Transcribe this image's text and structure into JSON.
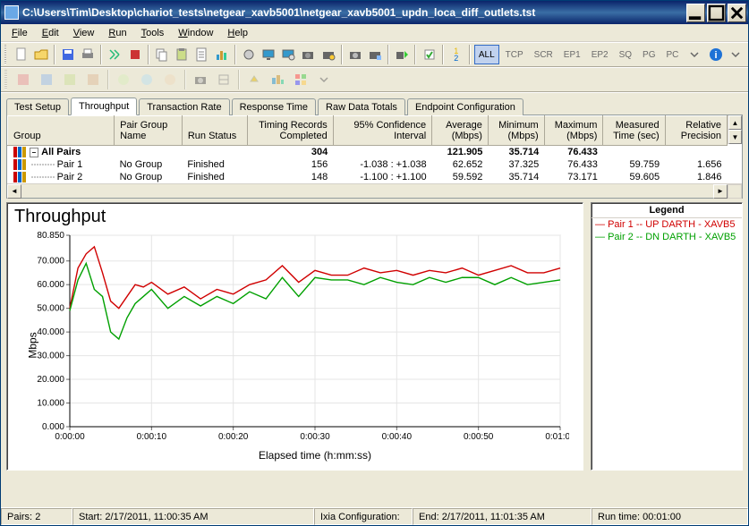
{
  "window": {
    "title": "C:\\Users\\Tim\\Desktop\\chariot_tests\\netgear_xavb5001\\netgear_xavb5001_updn_loca_diff_outlets.tst"
  },
  "menu": {
    "file": "File",
    "edit": "Edit",
    "view": "View",
    "run": "Run",
    "tools": "Tools",
    "window": "Window",
    "help": "Help"
  },
  "filter_buttons": {
    "all": "ALL",
    "tcp": "TCP",
    "scr": "SCR",
    "ep1": "EP1",
    "ep2": "EP2",
    "sq": "SQ",
    "pg": "PG",
    "pc": "PC",
    "halves": "1\n2"
  },
  "tabs": {
    "test_setup": "Test Setup",
    "throughput": "Throughput",
    "transaction_rate": "Transaction Rate",
    "response_time": "Response Time",
    "raw_data_totals": "Raw Data Totals",
    "endpoint_config": "Endpoint Configuration"
  },
  "columns": {
    "group": "Group",
    "pair_group_name": "Pair Group Name",
    "run_status": "Run Status",
    "timing_records": "Timing Records Completed",
    "confidence": "95% Confidence Interval",
    "average": "Average (Mbps)",
    "minimum": "Minimum (Mbps)",
    "maximum": "Maximum (Mbps)",
    "measured": "Measured Time (sec)",
    "precision": "Relative Precision"
  },
  "rows": [
    {
      "group": "All Pairs",
      "pg": "",
      "status": "",
      "records": "304",
      "conf": "",
      "avg": "121.905",
      "min": "35.714",
      "max": "76.433",
      "time": "",
      "prec": ""
    },
    {
      "group": "Pair 1",
      "pg": "No Group",
      "status": "Finished",
      "records": "156",
      "conf": "-1.038 : +1.038",
      "avg": "62.652",
      "min": "37.325",
      "max": "76.433",
      "time": "59.759",
      "prec": "1.656"
    },
    {
      "group": "Pair 2",
      "pg": "No Group",
      "status": "Finished",
      "records": "148",
      "conf": "-1.100 : +1.100",
      "avg": "59.592",
      "min": "35.714",
      "max": "73.171",
      "time": "59.605",
      "prec": "1.846"
    }
  ],
  "chart": {
    "title": "Throughput",
    "ylabel": "Mbps",
    "xlabel": "Elapsed time (h:mm:ss)",
    "legend_title": "Legend",
    "legend_items": [
      {
        "label": "Pair 1 -- UP DARTH - XAVB5",
        "color": "#d00000"
      },
      {
        "label": "Pair 2 -- DN DARTH - XAVB5",
        "color": "#00a000"
      }
    ]
  },
  "chart_data": {
    "type": "line",
    "title": "Throughput",
    "xlabel": "Elapsed time (h:mm:ss)",
    "ylabel": "Mbps",
    "ylim": [
      0,
      80.85
    ],
    "yticks": [
      0,
      10,
      20,
      30,
      40,
      50,
      60,
      70,
      80.85
    ],
    "x_categories": [
      "0:00:00",
      "0:00:10",
      "0:00:20",
      "0:00:30",
      "0:00:40",
      "0:00:50",
      "0:01:00"
    ],
    "x_seconds": [
      0,
      1,
      2,
      3,
      4,
      5,
      6,
      7,
      8,
      9,
      10,
      12,
      14,
      16,
      18,
      20,
      22,
      24,
      26,
      28,
      30,
      32,
      34,
      36,
      38,
      40,
      42,
      44,
      46,
      48,
      50,
      52,
      54,
      56,
      58,
      60
    ],
    "series": [
      {
        "name": "Pair 1 -- UP DARTH - XAVB5",
        "color": "#d00000",
        "values": [
          50,
          67,
          73,
          76,
          65,
          53,
          50,
          55,
          60,
          59,
          61,
          56,
          59,
          54,
          58,
          56,
          60,
          62,
          68,
          61,
          66,
          64,
          64,
          67,
          65,
          66,
          64,
          66,
          65,
          67,
          64,
          66,
          68,
          65,
          65,
          67
        ]
      },
      {
        "name": "Pair 2 -- DN DARTH - XAVB5",
        "color": "#00a000",
        "values": [
          49,
          62,
          69,
          58,
          55,
          40,
          37,
          46,
          52,
          55,
          58,
          50,
          55,
          51,
          55,
          52,
          57,
          54,
          63,
          55,
          63,
          62,
          62,
          60,
          63,
          61,
          60,
          63,
          61,
          63,
          63,
          60,
          63,
          60,
          61,
          62
        ]
      }
    ]
  },
  "status": {
    "pairs_label": "Pairs:",
    "pairs_value": "2",
    "start_label": "Start:",
    "start_value": "2/17/2011, 11:00:35 AM",
    "ixia_label": "Ixia Configuration:",
    "end_label": "End:",
    "end_value": "2/17/2011, 11:01:35 AM",
    "runtime_label": "Run time:",
    "runtime_value": "00:01:00"
  }
}
